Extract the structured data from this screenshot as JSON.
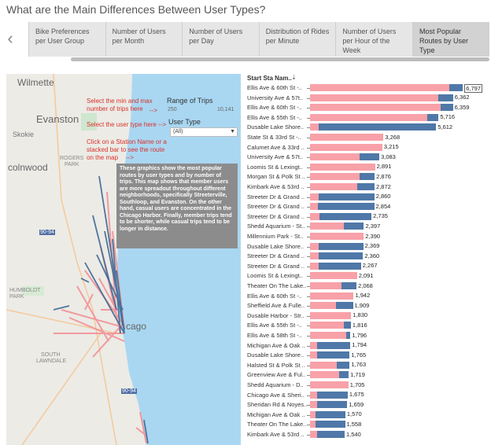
{
  "title": "What are the Main Differences Between User Types?",
  "tabs": [
    {
      "label": "Bike Preferences per User Group"
    },
    {
      "label": "Number of Users per Month"
    },
    {
      "label": "Number of Users per Day"
    },
    {
      "label": "Distribution of Rides per Minute"
    },
    {
      "label": "Number of Users per Hour of the Week"
    },
    {
      "label": "Most Popular Routes by User Type"
    }
  ],
  "active_tab": 5,
  "nav": {
    "prev_icon": "chevron-left-icon"
  },
  "map": {
    "places": [
      "Wilmette",
      "Evanston",
      "Skokie",
      "colnwood",
      "ROGERS",
      "PARK",
      "HUMBOLDT",
      "PARK",
      "SOUTH",
      "LAWNDALE",
      "cago",
      "90-94",
      "90-94"
    ],
    "notes": {
      "min_max": "Select the min and max\nnumber of trips here",
      "min_max_arrow": "-->",
      "user_type": "Select the user type here -->",
      "station": "Click on a Station Name or a\nstacked bar to see the route\non the map",
      "station_arrow": "-->"
    },
    "range_filter": {
      "title": "Range of Trips",
      "min": "250",
      "max": "10,141"
    },
    "user_type_filter": {
      "title": "User Type",
      "value": "(All)"
    },
    "info_box": "These graphics show the most popular routes by user types and by number of trips.  This map shows that member users are more spreadout throughout different neighborhoods, specifically Streeterville, Southloop, and Evanston. On the other hand, casual users are concentrated in the Chicago Harbor. Finally, member trips tend to be shorter, while casual trips tend to be longer in distance."
  },
  "chart_header": "Start Sta Nam..",
  "colors": {
    "casual": "#f8a1a8",
    "member": "#4f78a8",
    "lake": "#a9d7f2"
  },
  "chart_data": {
    "type": "bar",
    "stacked": true,
    "orientation": "horizontal",
    "categories": [
      "Ellis Ave & 60th St -..",
      "University Ave & 57t..",
      "Ellis Ave & 60th St -..",
      "Ellis Ave & 55th St -..",
      "Dusable Lake Shore..",
      "State St & 33rd St -..",
      "Calumet Ave & 33rd ..",
      "University Ave & 57t..",
      "Loomis St & Lexingt..",
      "Morgan St & Polk St ..",
      "Kimbark Ave & 53rd ..",
      "Streeter Dr & Grand ..",
      "Streeter Dr & Grand ..",
      "Streeter Dr & Grand ..",
      "Shedd Aquarium - St..",
      "Millennium Park - St..",
      "Dusable Lake Shore..",
      "Streeter Dr & Grand ..",
      "Streeter Dr & Grand ..",
      "Loomis St & Lexingt..",
      "Theater On The Lake..",
      "Ellis Ave & 60th St -..",
      "Sheffield Ave & Fulle..",
      "Dusable Harbor - Str..",
      "Ellis Ave & 55th St -..",
      "Ellis Ave & 58th St -..",
      "Michigan Ave & Oak ..",
      "Dusable Lake Shore..",
      "Halsted St & Polk St ..",
      "Greenview Ave & Ful..",
      "Shedd Aquarium - D..",
      "Chicago Ave & Sheri..",
      "Sheridan Rd & Noyes..",
      "Michigan Ave & Oak ..",
      "Theater On The Lake..",
      "Kimbark Ave & 53rd .."
    ],
    "totals": [
      6797,
      6362,
      6359,
      5716,
      5612,
      3268,
      3215,
      3083,
      2891,
      2876,
      2872,
      2860,
      2854,
      2735,
      2397,
      2390,
      2369,
      2360,
      2267,
      2091,
      2068,
      1942,
      1909,
      1830,
      1816,
      1796,
      1794,
      1765,
      1763,
      1719,
      1705,
      1675,
      1659,
      1570,
      1558,
      1540
    ],
    "total_labels": [
      "6,797",
      "6,362",
      "6,359",
      "5,716",
      "5,612",
      "3,268",
      "3,215",
      "3,083",
      "2,891",
      "2,876",
      "2,872",
      "2,860",
      "2,854",
      "2,735",
      "2,397",
      "2,390",
      "2,369",
      "2,360",
      "2,267",
      "2,091",
      "2,068",
      "1,942",
      "1,909",
      "1,830",
      "1,816",
      "1,796",
      "1,794",
      "1,765",
      "1,763",
      "1,719",
      "1,705",
      "1,675",
      "1,659",
      "1,570",
      "1,558",
      "1,540"
    ],
    "series": [
      {
        "values": [
          6200,
          5700,
          5800,
          5200,
          400,
          3268,
          3215,
          2200,
          2891,
          2200,
          2100,
          400,
          350,
          420,
          1500,
          2390,
          400,
          400,
          400,
          2091,
          1400,
          1942,
          1150,
          1830,
          1500,
          1600,
          300,
          300,
          1200,
          1300,
          1705,
          300,
          300,
          250,
          250,
          300
        ]
      },
      {
        "values": [
          597,
          662,
          559,
          516,
          5212,
          0,
          0,
          883,
          0,
          676,
          772,
          2460,
          2504,
          2315,
          897,
          0,
          1969,
          1960,
          1867,
          0,
          668,
          0,
          759,
          0,
          316,
          196,
          1494,
          1465,
          563,
          419,
          0,
          1375,
          1359,
          1320,
          1308,
          1240
        ]
      }
    ],
    "highlighted_index": 0,
    "xlim": [
      0,
      7000
    ]
  }
}
